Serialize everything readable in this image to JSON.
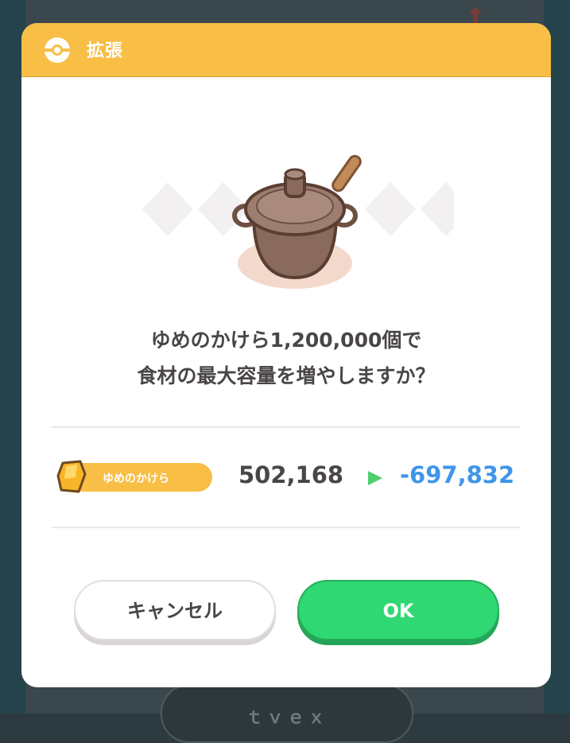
{
  "dialog": {
    "title": "拡張",
    "message_line1": "ゆめのかけら1,200,000個で",
    "message_line2": "食材の最大容量を増やしますか？",
    "illustration": "cooking-pot",
    "currency": {
      "label": "ゆめのかけら",
      "current": "502,168",
      "result": "-697,832",
      "icon": "dream-shard-icon"
    },
    "buttons": {
      "cancel": "キャンセル",
      "ok": "OK"
    }
  },
  "background": {
    "button_label": "ｔｖｅｘ"
  },
  "colors": {
    "header": "#f8be46",
    "ok_button": "#2fd872",
    "result_value": "#3f96e8",
    "text": "#4a4646"
  }
}
